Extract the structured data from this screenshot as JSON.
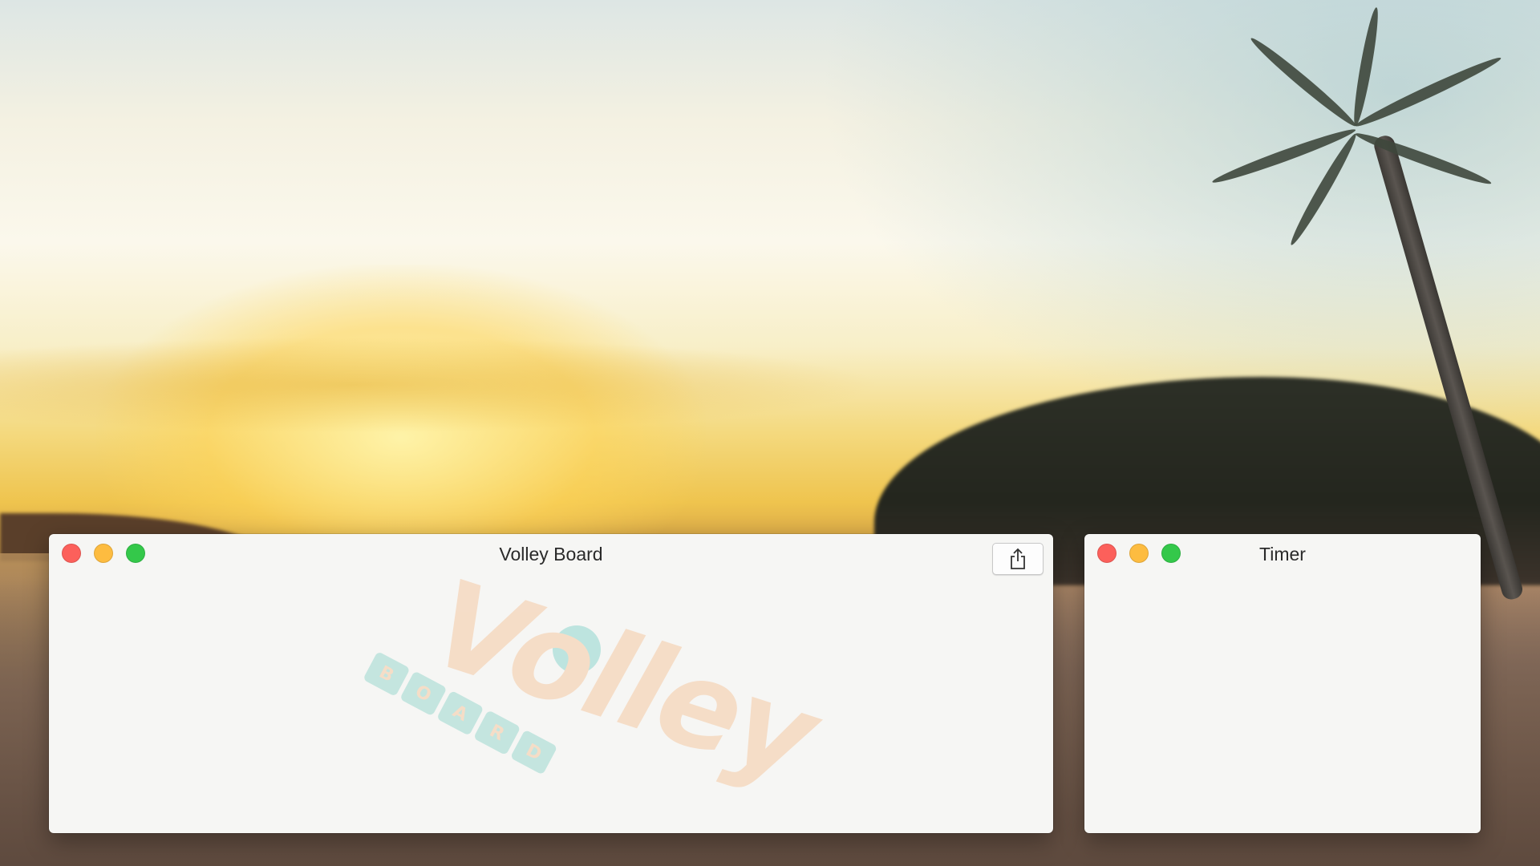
{
  "desktop": {
    "wallpaper": "beach-sunset-wallpaper"
  },
  "windows": {
    "volley": {
      "title": "Volley Board",
      "logo": {
        "wordmark": "Volley",
        "tiles": [
          "B",
          "O",
          "A",
          "R",
          "D"
        ]
      },
      "toolbar": {
        "share_icon": "share-icon"
      }
    },
    "timer": {
      "title": "Timer"
    }
  },
  "colors": {
    "close": "#fc605b",
    "minimize": "#fdbc40",
    "maximize": "#34c84a"
  }
}
